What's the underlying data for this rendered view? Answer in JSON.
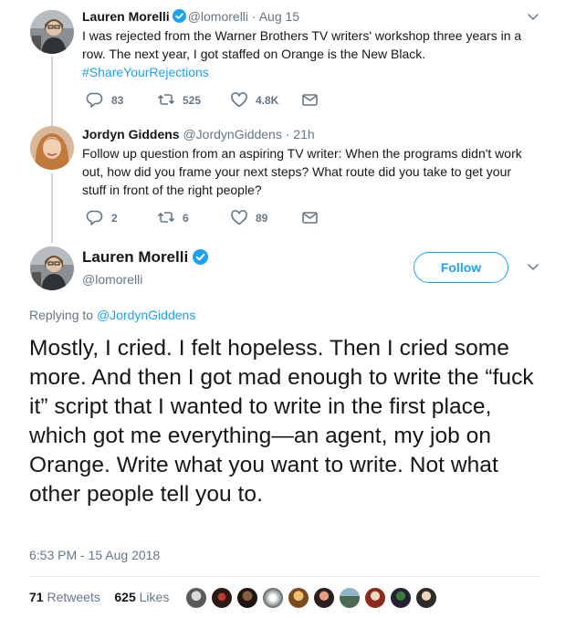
{
  "tweets": [
    {
      "name": "Lauren Morelli",
      "handle": "@lomorelli",
      "separator": "·",
      "time": "Aug 15",
      "text_line1": "I was rejected from the Warner Brothers TV writers' workshop three years in a",
      "text_line2": "row. The next year, I got staffed on Orange is the New Black.",
      "hashtag": "#ShareYourRejections",
      "replies": "83",
      "retweets": "525",
      "likes": "4.8K"
    },
    {
      "name": "Jordyn Giddens",
      "handle": "@JordynGiddens",
      "separator": "·",
      "time": "21h",
      "text_line1": "Follow up question from an aspiring TV writer: When the programs didn't work",
      "text_line2": "out, how did you frame your next steps? What route did you take to get your",
      "text_line3": "stuff in front of the right people?",
      "replies": "2",
      "retweets": "6",
      "likes": "89"
    }
  ],
  "main": {
    "name": "Lauren Morelli",
    "handle": "@lomorelli",
    "follow_label": "Follow",
    "replying_prefix": "Replying to",
    "replying_handle": "@JordynGiddens",
    "text": "Mostly, I cried. I felt hopeless. Then I cried some more. And then I got mad enough to write the “fuck it” script that I wanted to write in the first place, which got me everything—an agent, my job on Orange. Write what you want to write. Not what other people tell you to.",
    "timestamp": "6:53 PM - 15 Aug 2018",
    "retweets_count": "71",
    "retweets_label": "Retweets",
    "likes_count": "625",
    "likes_label": "Likes"
  },
  "colors": {
    "accent": "#1da1f2",
    "muted": "#657786",
    "text": "#14171a",
    "divider": "#e6ecf0"
  },
  "icons": [
    "verified-badge-icon",
    "chevron-down-icon",
    "reply-icon",
    "retweet-icon",
    "like-icon",
    "direct-message-icon"
  ]
}
